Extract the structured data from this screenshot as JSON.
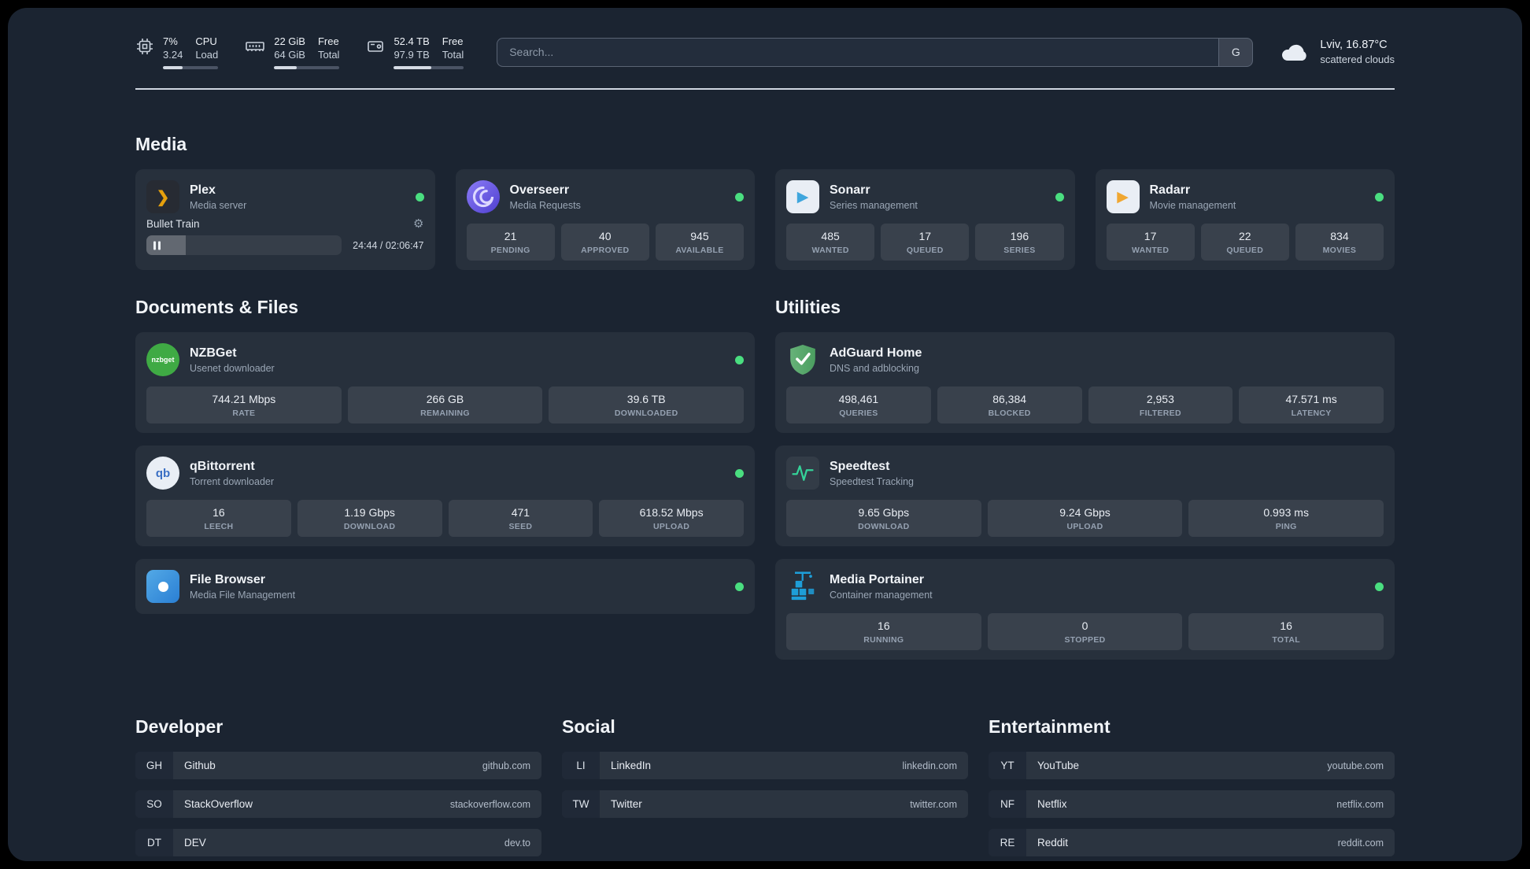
{
  "colors": {
    "status_ok": "#4ade80",
    "accent_plex": "#e5a00d"
  },
  "icons": {
    "gear": "⚙",
    "plex_glyph": "❯",
    "play_glyph": "▶"
  },
  "header": {
    "cpu": {
      "value": "7%",
      "sub": "3.24",
      "label": "CPU",
      "sublabel": "Load",
      "pct": 35
    },
    "ram": {
      "value": "22 GiB",
      "sub": "64 GiB",
      "label": "Free",
      "sublabel": "Total",
      "pct": 35
    },
    "disk": {
      "value": "52.4 TB",
      "sub": "97.9 TB",
      "label": "Free",
      "sublabel": "Total",
      "pct": 54
    },
    "search": {
      "placeholder": "Search...",
      "button": "G"
    },
    "weather": {
      "location": "Lviv, 16.87°C",
      "condition": "scattered clouds"
    }
  },
  "media": {
    "title": "Media",
    "plex": {
      "name": "Plex",
      "desc": "Media server",
      "now_playing": "Bullet Train",
      "time": "24:44 / 02:06:47",
      "progress_pct": 20
    },
    "overseerr": {
      "name": "Overseerr",
      "desc": "Media Requests",
      "stats": [
        {
          "value": "21",
          "label": "PENDING"
        },
        {
          "value": "40",
          "label": "APPROVED"
        },
        {
          "value": "945",
          "label": "AVAILABLE"
        }
      ]
    },
    "sonarr": {
      "name": "Sonarr",
      "desc": "Series management",
      "stats": [
        {
          "value": "485",
          "label": "WANTED"
        },
        {
          "value": "17",
          "label": "QUEUED"
        },
        {
          "value": "196",
          "label": "SERIES"
        }
      ]
    },
    "radarr": {
      "name": "Radarr",
      "desc": "Movie management",
      "stats": [
        {
          "value": "17",
          "label": "WANTED"
        },
        {
          "value": "22",
          "label": "QUEUED"
        },
        {
          "value": "834",
          "label": "MOVIES"
        }
      ]
    }
  },
  "documents": {
    "title": "Documents & Files",
    "nzbget": {
      "name": "NZBGet",
      "desc": "Usenet downloader",
      "icon_text": "nzbget",
      "stats": [
        {
          "value": "744.21 Mbps",
          "label": "RATE"
        },
        {
          "value": "266 GB",
          "label": "REMAINING"
        },
        {
          "value": "39.6 TB",
          "label": "DOWNLOADED"
        }
      ]
    },
    "qbittorrent": {
      "name": "qBittorrent",
      "desc": "Torrent downloader",
      "icon_text": "qb",
      "stats": [
        {
          "value": "16",
          "label": "LEECH"
        },
        {
          "value": "1.19 Gbps",
          "label": "DOWNLOAD"
        },
        {
          "value": "471",
          "label": "SEED"
        },
        {
          "value": "618.52 Mbps",
          "label": "UPLOAD"
        }
      ]
    },
    "filebrowser": {
      "name": "File Browser",
      "desc": "Media File Management"
    }
  },
  "utilities": {
    "title": "Utilities",
    "adguard": {
      "name": "AdGuard Home",
      "desc": "DNS and adblocking",
      "stats": [
        {
          "value": "498,461",
          "label": "QUERIES"
        },
        {
          "value": "86,384",
          "label": "BLOCKED"
        },
        {
          "value": "2,953",
          "label": "FILTERED"
        },
        {
          "value": "47.571 ms",
          "label": "LATENCY"
        }
      ]
    },
    "speedtest": {
      "name": "Speedtest",
      "desc": "Speedtest Tracking",
      "stats": [
        {
          "value": "9.65 Gbps",
          "label": "DOWNLOAD"
        },
        {
          "value": "9.24 Gbps",
          "label": "UPLOAD"
        },
        {
          "value": "0.993 ms",
          "label": "PING"
        }
      ]
    },
    "portainer": {
      "name": "Media Portainer",
      "desc": "Container management",
      "stats": [
        {
          "value": "16",
          "label": "RUNNING"
        },
        {
          "value": "0",
          "label": "STOPPED"
        },
        {
          "value": "16",
          "label": "TOTAL"
        }
      ]
    }
  },
  "bookmarks": {
    "developer": {
      "title": "Developer",
      "items": [
        {
          "abbr": "GH",
          "name": "Github",
          "url": "github.com"
        },
        {
          "abbr": "SO",
          "name": "StackOverflow",
          "url": "stackoverflow.com"
        },
        {
          "abbr": "DT",
          "name": "DEV",
          "url": "dev.to"
        }
      ]
    },
    "social": {
      "title": "Social",
      "items": [
        {
          "abbr": "LI",
          "name": "LinkedIn",
          "url": "linkedin.com"
        },
        {
          "abbr": "TW",
          "name": "Twitter",
          "url": "twitter.com"
        }
      ]
    },
    "entertainment": {
      "title": "Entertainment",
      "items": [
        {
          "abbr": "YT",
          "name": "YouTube",
          "url": "youtube.com"
        },
        {
          "abbr": "NF",
          "name": "Netflix",
          "url": "netflix.com"
        },
        {
          "abbr": "RE",
          "name": "Reddit",
          "url": "reddit.com"
        }
      ]
    }
  }
}
